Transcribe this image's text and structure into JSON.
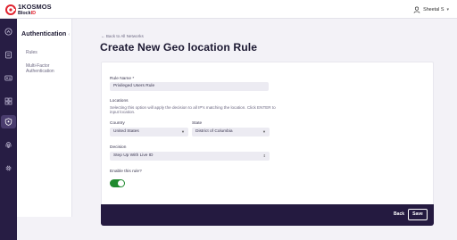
{
  "brand": {
    "name_line1": "1KOSMOS",
    "name_line2_a": "Block",
    "name_line2_b": "ID"
  },
  "header": {
    "user_name": "Sheetal S",
    "user_caret": "▾"
  },
  "rail": {
    "items": [
      "home-icon",
      "document-icon",
      "id-card-icon",
      "apps-grid-icon",
      "shield-icon",
      "fingerprint-icon",
      "settings-icon"
    ],
    "active": "shield-icon"
  },
  "subnav": {
    "title": "Authentication",
    "title_chevron": "‹",
    "items": [
      "Rules",
      "Multi-Factor Authentication"
    ]
  },
  "page": {
    "back_link": "← Back to All Networks",
    "title": "Create New Geo location Rule"
  },
  "form": {
    "rule_name_label": "Rule Name *",
    "rule_name_value": "Privileged Users Rule",
    "locations_label": "Locations",
    "locations_help": "Selecting this option will apply the decision to all IP's matching the location. Click ENTER to input location.",
    "country_label": "Country",
    "country_value": "United States",
    "state_label": "State",
    "state_value": "District of Columbia",
    "decision_label": "Decision",
    "decision_value": "Step Up With Live ID",
    "enable_label": "Enable this rule?",
    "enabled": true
  },
  "footer": {
    "back_label": "Back",
    "save_label": "Save"
  },
  "colors": {
    "rail_bg": "#271d44",
    "footer_bg": "#241a40",
    "toggle_on": "#1f8a2e",
    "brand_red": "#e0222e",
    "field_bg": "#ecebf2"
  }
}
